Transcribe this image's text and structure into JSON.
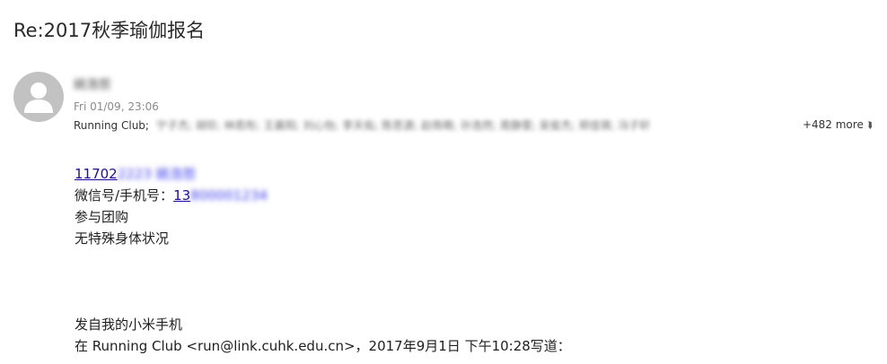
{
  "email": {
    "subject": "Re:2017秋季瑜伽报名",
    "sender_name": "姚浩哲",
    "timestamp": "Fri 01/09, 23:06",
    "recipients_first": "Running Club;",
    "recipients_blurred": "宁子杰; 胡珍; 林若彤; 王晨阳; 刘心怡; 李天佑; 陈思源; 赵雨萌; 孙浩然; 周静雯; 吴俊杰; 郑佳琪; 冯子轩",
    "more_recipients": "+482 more",
    "body": {
      "student_id_visible": "11702",
      "student_id_blurred": "2223 姚浩哲",
      "wechat_label": "微信号/手机号：",
      "phone_visible": "13",
      "phone_blurred": "800001234",
      "line3": "参与团购",
      "line4": "无特殊身体状况",
      "signature": "发自我的小米手机",
      "quote_header": "在 Running Club <run@link.cuhk.edu.cn>，2017年9月1日 下午10:28写道："
    }
  },
  "colors": {
    "link": "#1a0dab",
    "avatar_bg": "#c2c2c2",
    "text": "#1f1f1f",
    "meta": "#8a8a8a"
  },
  "icons": {
    "avatar": "person-silhouette-icon",
    "expand": "double-chevron-down-icon"
  }
}
